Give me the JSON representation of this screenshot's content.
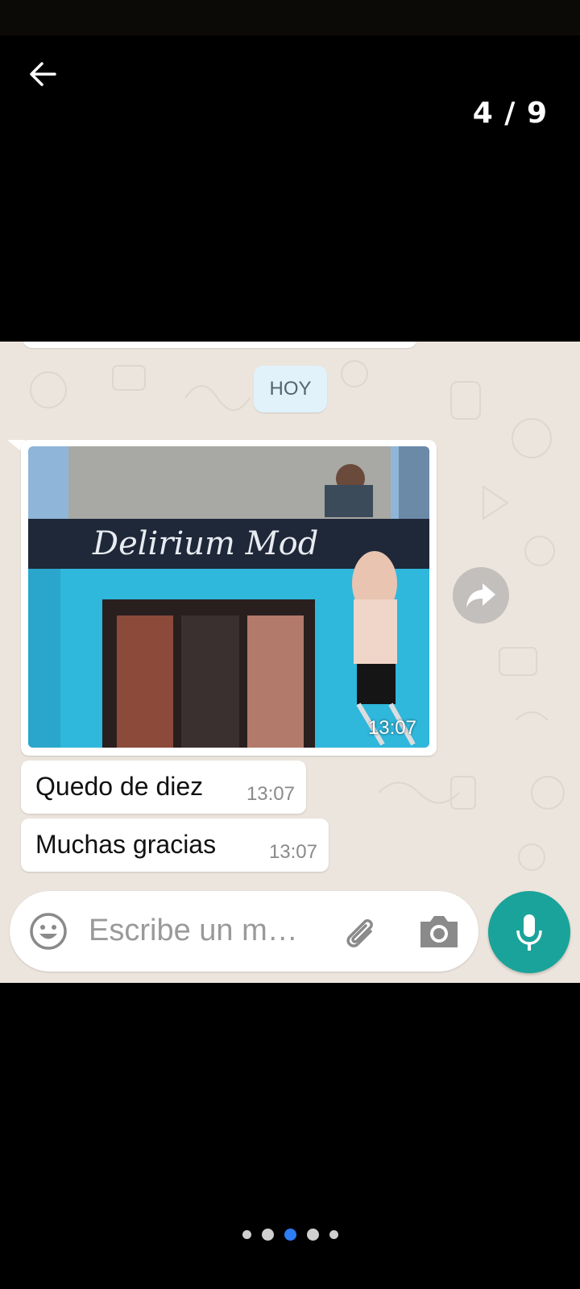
{
  "viewer": {
    "counter": "4 / 9",
    "back_icon": "arrow-left-icon"
  },
  "chat": {
    "date_chip": "HOY",
    "image_message": {
      "time": "13:07",
      "sign_text": "Delirium Mod"
    },
    "messages": [
      {
        "text": "Quedo de diez",
        "time": "13:07"
      },
      {
        "text": "Muchas gracias",
        "time": "13:07"
      }
    ],
    "input": {
      "placeholder": "Escribe un m…"
    }
  },
  "pager": {
    "total": 5,
    "active_index": 2
  },
  "colors": {
    "chat_bg": "#ece5dd",
    "bubble": "#ffffff",
    "date_chip": "#e1f2fa",
    "mic_button": "#1aa39a",
    "pager_active": "#2e7cf6"
  }
}
